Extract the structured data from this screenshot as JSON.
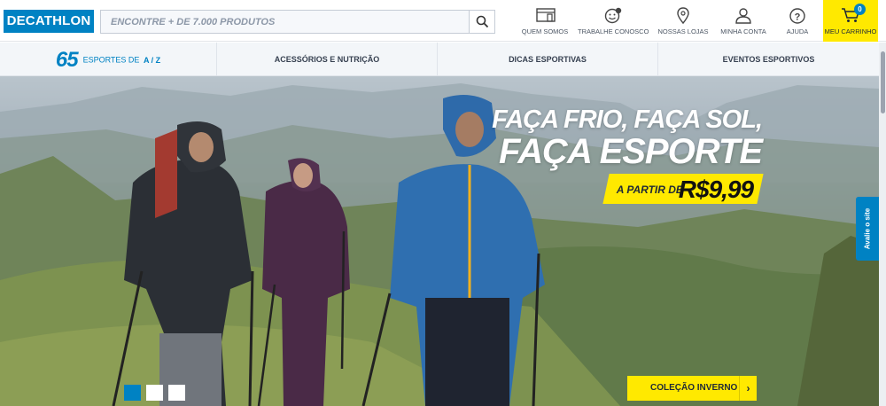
{
  "header": {
    "logo": "DECATHLON",
    "search_placeholder": "ENCONTRE + DE 7.000 PRODUTOS",
    "nav": [
      {
        "label": "QUEM SOMOS",
        "icon": "storefront-icon"
      },
      {
        "label": "TRABALHE CONOSCO",
        "icon": "smiley-icon"
      },
      {
        "label": "NOSSAS LOJAS",
        "icon": "map-pin-icon"
      },
      {
        "label": "MINHA CONTA",
        "icon": "user-icon"
      },
      {
        "label": "AJUDA",
        "icon": "help-icon"
      }
    ],
    "cart": {
      "label": "MEU CARRINHO",
      "count": "0",
      "icon": "cart-icon"
    }
  },
  "categories": {
    "sports": {
      "count": "65",
      "label": "ESPORTES DE",
      "label_strong": "A / Z"
    },
    "items": [
      "ACESSÓRIOS E NUTRIÇÃO",
      "DICAS ESPORTIVAS",
      "EVENTOS ESPORTIVOS"
    ]
  },
  "hero": {
    "line1": "FAÇA FRIO, FAÇA SOL,",
    "line2": "FAÇA ESPORTE",
    "price_prefix": "A PARTIR DE",
    "price": "R$9,99",
    "cta": "COLEÇÃO INVERNO",
    "cta_icon": "chevron-right-icon",
    "slides": 3,
    "active_slide": 1
  },
  "side_tab": "Avalie o site",
  "colors": {
    "brand_blue": "#0082c3",
    "accent_yellow": "#ffe900"
  }
}
